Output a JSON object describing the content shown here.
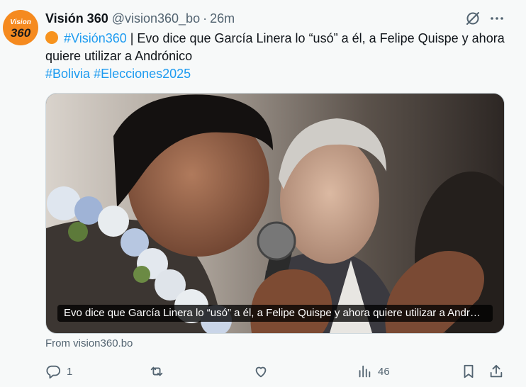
{
  "tweet": {
    "avatar": {
      "line1": "Vision",
      "line2": "360",
      "color": "#f58a1f"
    },
    "author_name": "Visión 360",
    "handle": "@vision360_bo",
    "separator": "·",
    "time": "26m",
    "hashtag_lead": "#Visión360",
    "text_main": " | Evo dice que García Linera lo “usó” a él, a Felipe Quispe y ahora quiere utilizar a Andrónico",
    "hashtag_1": "#Bolivia",
    "hashtag_2": "#Elecciones2025",
    "media_caption": "Evo dice que García Linera lo “usó” a él, a Felipe Quispe y ahora quiere utilizar a Andrónico",
    "source": "From vision360.bo",
    "replies": "1",
    "views": "46",
    "accent_color": "#1d9bf0",
    "icons": [
      "grok-icon",
      "more-icon",
      "reply-icon",
      "retweet-icon",
      "like-icon",
      "views-icon",
      "bookmark-icon",
      "share-icon"
    ]
  }
}
